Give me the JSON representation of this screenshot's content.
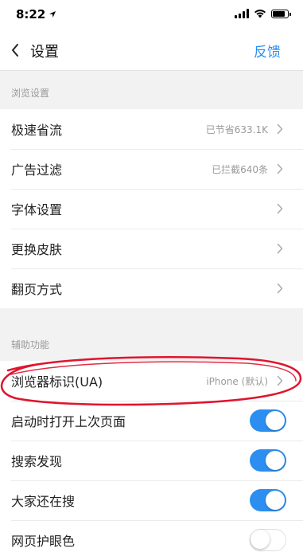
{
  "status_bar": {
    "time": "8:22",
    "battery_level": 0.9
  },
  "nav": {
    "title": "设置",
    "feedback": "反馈"
  },
  "sections": [
    {
      "header": "浏览设置",
      "items": [
        {
          "label": "极速省流",
          "value": "已节省633.1K"
        },
        {
          "label": "广告过滤",
          "value": "已拦截640条"
        },
        {
          "label": "字体设置",
          "value": ""
        },
        {
          "label": "更换皮肤",
          "value": ""
        },
        {
          "label": "翻页方式",
          "value": ""
        }
      ]
    },
    {
      "header": "辅助功能",
      "items": [
        {
          "label": "浏览器标识(UA)",
          "value": "iPhone (默认)"
        },
        {
          "label": "启动时打开上次页面",
          "toggle": true
        },
        {
          "label": "搜索发现",
          "toggle": true
        },
        {
          "label": "大家还在搜",
          "toggle": true
        },
        {
          "label": "网页护眼色",
          "toggle": false
        }
      ]
    }
  ],
  "colors": {
    "accent": "#2b8ef0",
    "annotation": "#e0142e",
    "background": "#f2f2f2"
  },
  "icons": {
    "back": "chevron-left-icon",
    "row": "chevron-right-icon",
    "location": "location-arrow-icon",
    "wifi": "wifi-icon",
    "signal": "cellular-signal-icon",
    "battery": "battery-icon"
  }
}
